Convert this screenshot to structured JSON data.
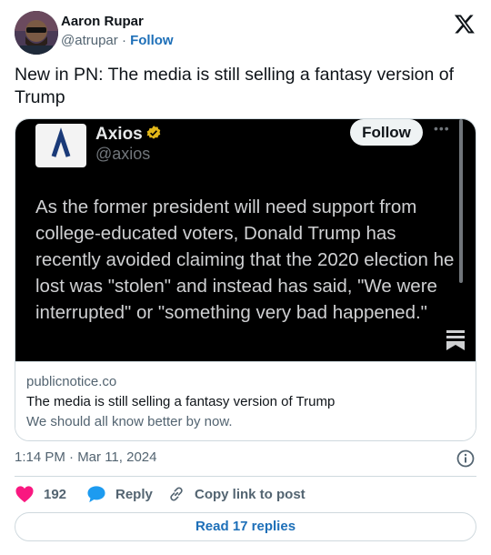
{
  "author": {
    "name": "Aaron Rupar",
    "handle": "@atrupar",
    "separator": "·",
    "follow_label": "Follow"
  },
  "tweet": {
    "text": "New in PN: The media is still selling a fantasy version of Trump"
  },
  "card": {
    "embedded_post": {
      "account_name": "Axios",
      "account_handle": "@axios",
      "follow_label": "Follow",
      "more_label": "•••",
      "quote": "As the former president will need support from college-educated voters, Donald Trump has recently avoided claiming that the 2020 election he lost was \"stolen\" and instead has said, \"We were interrupted\" or \"something very bad happened.\""
    },
    "domain": "publicnotice.co",
    "title": "The media is still selling a fantasy version of Trump",
    "description": "We should all know better by now."
  },
  "timestamp": "1:14 PM · Mar 11, 2024",
  "actions": {
    "like_count": "192",
    "reply_label": "Reply",
    "copy_label": "Copy link to post"
  },
  "read_replies_label": "Read 17 replies",
  "colors": {
    "like": "#f91880",
    "reply": "#1d9bf0",
    "link": "#1d6fb8",
    "verified_gold": "#e2b719"
  },
  "icons": [
    "x-logo-icon",
    "verified-badge-icon",
    "bookmark-icon",
    "info-icon",
    "heart-icon",
    "reply-bubble-icon",
    "link-icon"
  ]
}
